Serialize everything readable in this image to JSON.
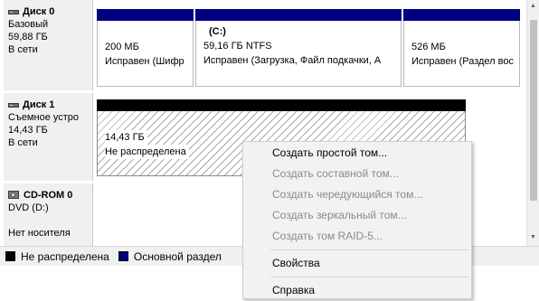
{
  "colors": {
    "primary_partition": "#000080",
    "unallocated": "#000000",
    "disk_cell_bg": "#f0f0f0",
    "menu_bg": "#f2f2f2",
    "disabled_text": "#8a8a8a"
  },
  "disks": [
    {
      "name": "Диск 0",
      "icon": "hard-disk-icon",
      "lines": [
        "Базовый",
        "59,88 ГБ",
        "В сети"
      ],
      "partitions": [
        {
          "line1": "200 МБ",
          "line2": "Исправен (Шифр"
        },
        {
          "title": "(C:)",
          "line1": "59,16 ГБ NTFS",
          "line2": "Исправен (Загрузка, Файл подкачки, А"
        },
        {
          "line1": "526 МБ",
          "line2": "Исправен (Раздел вос"
        }
      ]
    },
    {
      "name": "Диск 1",
      "icon": "hard-disk-icon",
      "lines": [
        "Съемное устро",
        "14,43 ГБ",
        "В сети"
      ],
      "partitions": [
        {
          "line1": "14,43 ГБ",
          "line2": "Не распределена"
        }
      ]
    },
    {
      "name": "CD-ROM 0",
      "icon": "cdrom-icon",
      "lines": [
        "DVD (D:)",
        "",
        "Нет носителя"
      ]
    }
  ],
  "legend": [
    {
      "label": "Не распределена",
      "color": "#000000"
    },
    {
      "label": "Основной раздел",
      "color": "#000080"
    }
  ],
  "context_menu": {
    "items": [
      {
        "label": "Создать простой том...",
        "enabled": true
      },
      {
        "label": "Создать составной том...",
        "enabled": false
      },
      {
        "label": "Создать чередующийся том...",
        "enabled": false
      },
      {
        "label": "Создать зеркальный том...",
        "enabled": false
      },
      {
        "label": "Создать том RAID-5...",
        "enabled": false
      },
      {
        "label": "Свойства",
        "enabled": true
      },
      {
        "label": "Справка",
        "enabled": true
      }
    ]
  }
}
